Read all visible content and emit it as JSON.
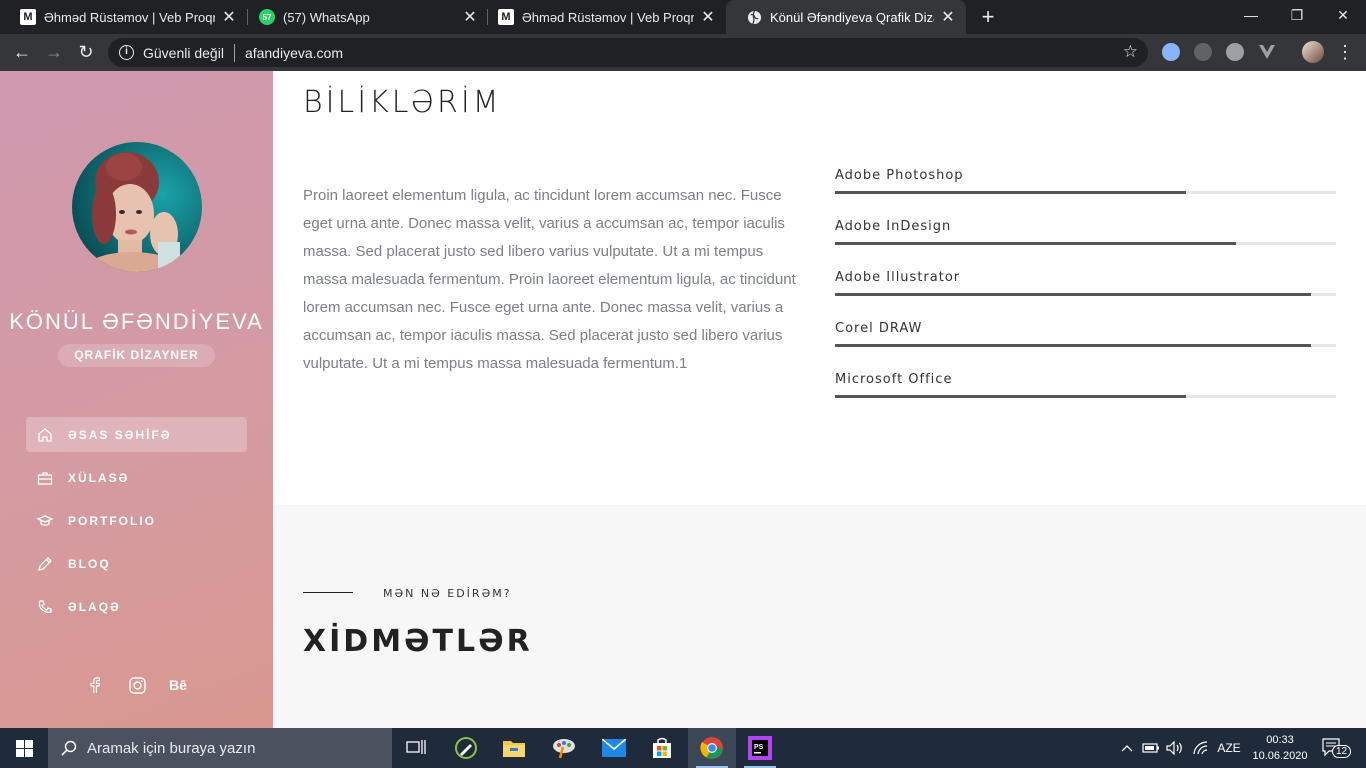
{
  "browser": {
    "tabs": [
      {
        "title": "Əhməd Rüstəmov | Veb Proqram",
        "favicon": "M"
      },
      {
        "title": "(57) WhatsApp",
        "favicon": "57"
      },
      {
        "title": "Əhməd Rüstəmov | Veb Proqram",
        "favicon": "M"
      },
      {
        "title": "Könül Əfəndiyeva Qrafik Dizayne",
        "favicon": "globe-icon",
        "active": true
      }
    ],
    "new_tab": "+",
    "security_text": "Güvenli değil",
    "url": "afandiyeva.com"
  },
  "sidebar": {
    "name": "KÖNÜL ƏFƏNDİYEVA",
    "role": "QRAFİK DİZAYNER",
    "nav": [
      {
        "label": "ƏSAS SƏHİFƏ",
        "icon": "home-icon",
        "active": true
      },
      {
        "label": "XÜLASƏ",
        "icon": "briefcase-icon"
      },
      {
        "label": "PORTFOLIO",
        "icon": "graduation-cap-icon"
      },
      {
        "label": "BLOQ",
        "icon": "pencil-icon"
      },
      {
        "label": "ƏLAQƏ",
        "icon": "phone-icon"
      }
    ],
    "social": [
      "facebook-icon",
      "instagram-icon",
      "behance-icon"
    ],
    "social_behance_text": "Bē"
  },
  "skills_section": {
    "title": "BİLİKLƏRİM",
    "text": "Proin laoreet elementum ligula, ac tincidunt lorem accumsan nec. Fusce eget urna ante. Donec massa velit, varius a accumsan ac, tempor iaculis massa. Sed placerat justo sed libero varius vulputate. Ut a mi tempus massa malesuada fermentum. Proin laoreet elementum ligula, ac tincidunt lorem accumsan nec. Fusce eget urna ante. Donec massa velit, varius a accumsan ac, tempor iaculis massa. Sed placerat justo sed libero varius vulputate. Ut a mi tempus massa malesuada fermentum.1",
    "skills": [
      {
        "name": "Adobe Photoshop",
        "level": 70
      },
      {
        "name": "Adobe InDesign",
        "level": 80
      },
      {
        "name": "Adobe Illustrator",
        "level": 95
      },
      {
        "name": "Corel DRAW",
        "level": 95
      },
      {
        "name": "Microsoft Office",
        "level": 70
      }
    ]
  },
  "services_section": {
    "subtitle": "MƏN NƏ EDİRƏM?",
    "title": "XİDMƏTLƏR"
  },
  "taskbar": {
    "search_placeholder": "Aramak için buraya yazın",
    "language": "AZE",
    "time": "00:33",
    "date": "10.06.2020",
    "notifications": "12"
  },
  "colors": {
    "sidebar_top": "#cf98ae",
    "sidebar_bottom": "#d9978f",
    "skill_bar": "#555555"
  }
}
